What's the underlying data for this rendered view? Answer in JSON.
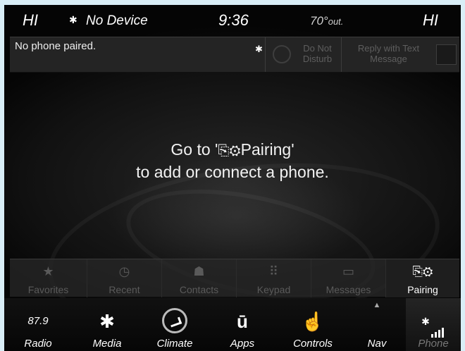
{
  "status": {
    "left_temp": "HI",
    "device_text": "No Device",
    "bt_icon": "bluetooth-icon",
    "time": "9:36",
    "outside_temp": "70°",
    "outside_suffix": "out.",
    "right_temp": "HI"
  },
  "phone_status": {
    "message": "No phone paired.",
    "dnd_label": "Do Not\nDisturb",
    "reply_label": "Reply with Text\nMessage"
  },
  "center": {
    "line1_prefix": "Go to '",
    "line1_glyph": "⎘⚙",
    "line1_suffix": "Pairing'",
    "line2": "to add or connect a phone."
  },
  "tabs": [
    {
      "label": "Favorites",
      "icon": "★",
      "icon_name": "star-icon"
    },
    {
      "label": "Recent",
      "icon": "◷",
      "icon_name": "clock-icon"
    },
    {
      "label": "Contacts",
      "icon": "☗",
      "icon_name": "person-icon"
    },
    {
      "label": "Keypad",
      "icon": "⠿",
      "icon_name": "keypad-icon"
    },
    {
      "label": "Messages",
      "icon": "▭",
      "icon_name": "message-icon"
    },
    {
      "label": "Pairing",
      "icon": "⎘⚙",
      "icon_name": "pairing-icon"
    }
  ],
  "nav": {
    "radio_freq": "87.9",
    "radio": "Radio",
    "media": "Media",
    "climate": "Climate",
    "apps": "Apps",
    "controls": "Controls",
    "nav": "Nav",
    "phone": "Phone",
    "media_icon": "✱",
    "apps_icon": "ū",
    "controls_icon": "☝"
  },
  "colors": {
    "frame": "#d9eef7",
    "active_text": "#ffffff",
    "dim_text": "#5a5a5a"
  }
}
